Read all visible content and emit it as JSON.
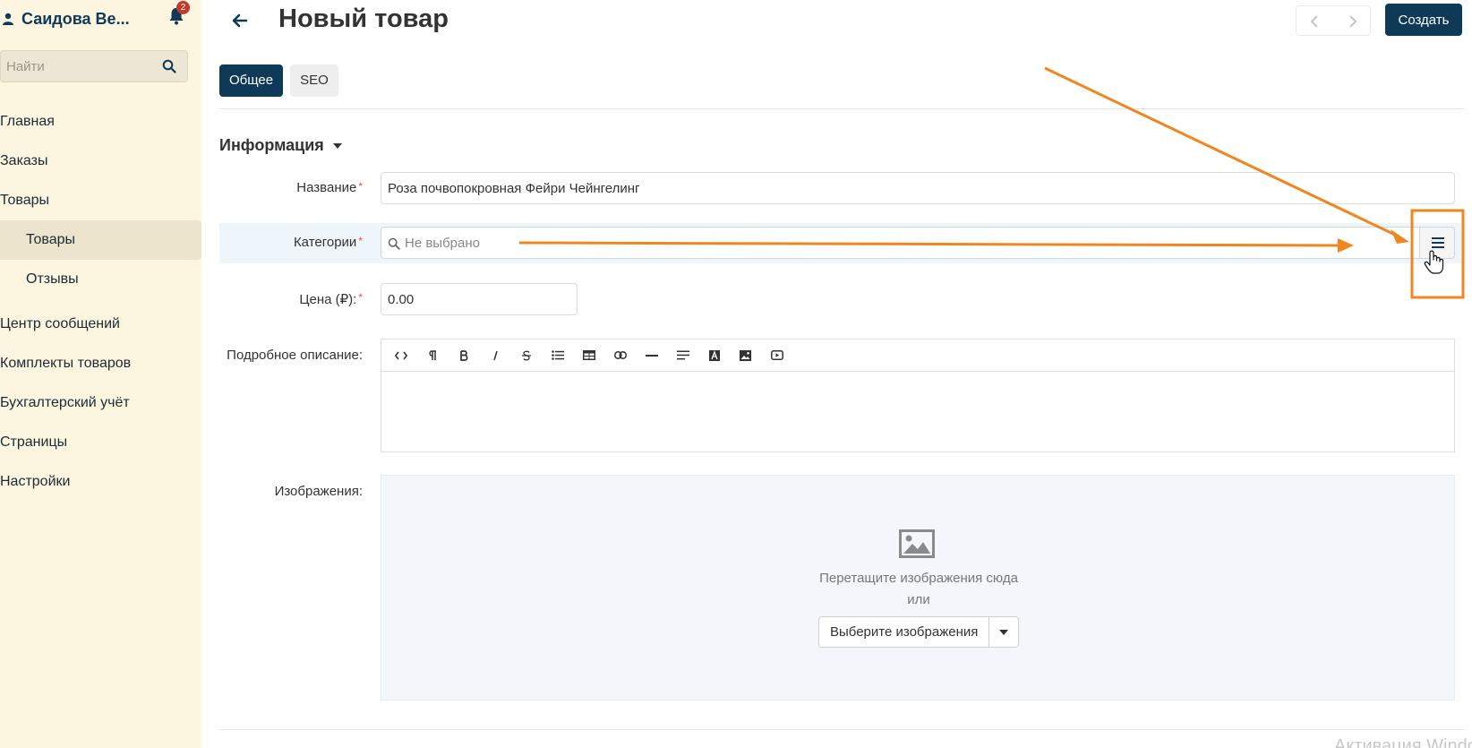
{
  "sidebar": {
    "user_name": "Саидова Ве...",
    "notifications_count": "2",
    "search_placeholder": "Найти",
    "items": [
      {
        "label": "Главная"
      },
      {
        "label": "Заказы"
      },
      {
        "label": "Товары"
      },
      {
        "label": "Товары"
      },
      {
        "label": "Отзывы"
      },
      {
        "label": "Центр сообщений"
      },
      {
        "label": "Комплекты товаров"
      },
      {
        "label": "Бухгалтерский учёт"
      },
      {
        "label": "Страницы"
      },
      {
        "label": "Настройки"
      }
    ]
  },
  "header": {
    "title": "Новый товар",
    "create_label": "Создать"
  },
  "tabs": [
    {
      "label": "Общее",
      "active": true
    },
    {
      "label": "SEO",
      "active": false
    }
  ],
  "section": {
    "title": "Информация"
  },
  "form": {
    "name_label": "Название",
    "name_value": "Роза почвопокровная Фейри Чейнгелинг",
    "categories_label": "Категории",
    "categories_placeholder": "Не выбрано",
    "price_label": "Цена (₽):",
    "price_value": "0.00",
    "description_label": "Подробное описание:",
    "images_label": "Изображения:",
    "required_mark": "*"
  },
  "dropzone": {
    "text": "Перетащите изображения сюда",
    "or_text": "или",
    "button_label": "Выберите изображения"
  },
  "watermark": "Активация Windows",
  "colors": {
    "primary": "#0e3a57",
    "sidebar_bg": "#fcf5df",
    "annotation": "#f0861f",
    "required": "#d9534f"
  }
}
